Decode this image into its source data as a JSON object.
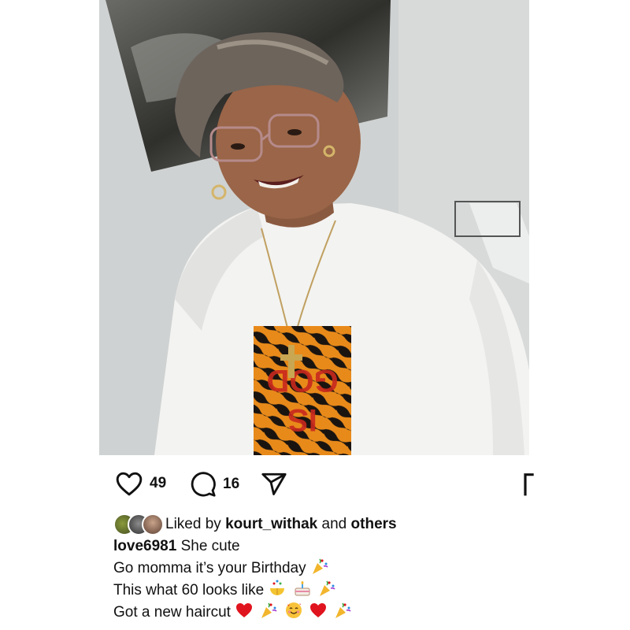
{
  "post": {
    "image_alt": "Woman in glasses and white t-shirt smiling",
    "shirt_text": "GOD IS DOPE"
  },
  "actions": {
    "like_count": "49",
    "comment_count": "16"
  },
  "likes": {
    "prefix": "Liked by",
    "user": "kourt_withak",
    "conjunction": "and",
    "others": "others"
  },
  "caption": {
    "username": "love6981",
    "lines": [
      "She cute",
      "Go momma it’s your Birthday",
      "This what 60 looks like",
      "Got a new haircut"
    ]
  },
  "colors": {
    "heart_red": "#e0141e",
    "text": "#111111",
    "background": "#ffffff"
  }
}
